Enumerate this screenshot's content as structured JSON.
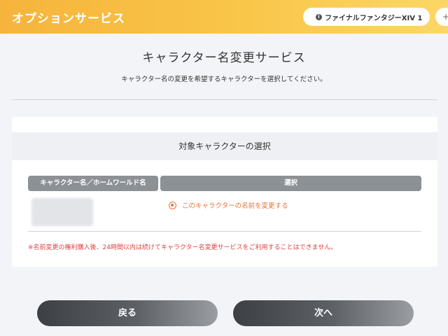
{
  "header": {
    "title": "オプションサービス",
    "game_label": "ファイナルファンタジーXIV 1",
    "game_icon": "info-icon",
    "add_label": "+"
  },
  "page": {
    "title": "キャラクター名変更サービス",
    "subtitle": "キャラクター名の変更を希望するキャラクターを選択してください。"
  },
  "selection": {
    "section_title": "対象キャラクターの選択",
    "columns": [
      "キャラクター名／ホームワールド名",
      "選択"
    ],
    "rows": [
      {
        "option_label": "このキャラクターの名前を変更する",
        "selected": true
      }
    ],
    "notice": "※名前変更の権利購入後、24時間以内は続けてキャラクター名変更サービスをご利用することはできません。"
  },
  "buttons": {
    "back_label": "戻る",
    "next_label": "次へ"
  },
  "colors": {
    "header_gradient_start": "#f6b43c",
    "header_gradient_end": "#fbd766",
    "accent_orange": "#e8743b",
    "notice_red": "#e04040",
    "table_header": "#8c9196"
  }
}
